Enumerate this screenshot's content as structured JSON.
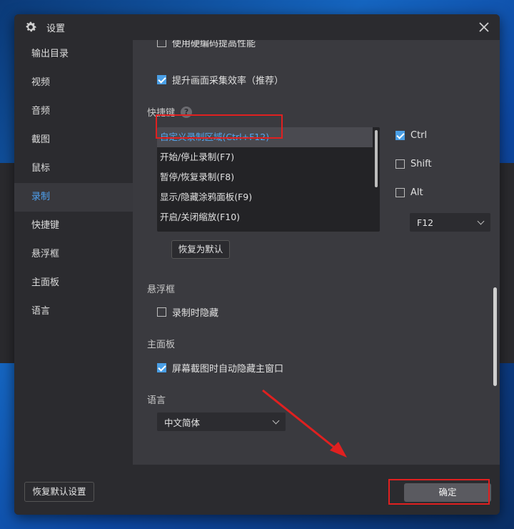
{
  "window": {
    "title": "设置",
    "close_icon": "close-icon",
    "settings_icon": "gear-icon"
  },
  "sidebar": {
    "items": [
      {
        "label": "输出目录",
        "active": false
      },
      {
        "label": "视频",
        "active": false
      },
      {
        "label": "音频",
        "active": false
      },
      {
        "label": "截图",
        "active": false
      },
      {
        "label": "鼠标",
        "active": false
      },
      {
        "label": "录制",
        "active": true
      },
      {
        "label": "快捷键",
        "active": false
      },
      {
        "label": "悬浮框",
        "active": false
      },
      {
        "label": "主面板",
        "active": false
      },
      {
        "label": "语言",
        "active": false
      }
    ]
  },
  "recording": {
    "hw_encode_label": "使用硬编码提高性能",
    "hw_encode_checked": false,
    "capture_efficiency_label": "提升画面采集效率（推荐）",
    "capture_efficiency_checked": true
  },
  "hotkeys": {
    "section_title": "快捷键",
    "help_icon": "help-icon",
    "list": [
      {
        "label": "自定义录制区域(Ctrl+F12)",
        "selected": true
      },
      {
        "label": "开始/停止录制(F7)",
        "selected": false
      },
      {
        "label": "暂停/恢复录制(F8)",
        "selected": false
      },
      {
        "label": "显示/隐藏涂鸦面板(F9)",
        "selected": false
      },
      {
        "label": "开启/关闭缩放(F10)",
        "selected": false
      }
    ],
    "ctrl_label": "Ctrl",
    "ctrl_checked": true,
    "shift_label": "Shift",
    "shift_checked": false,
    "alt_label": "Alt",
    "alt_checked": false,
    "key_value": "F12",
    "reset_label": "恢复为默认"
  },
  "float": {
    "section_title": "悬浮框",
    "hide_label": "录制时隐藏",
    "hide_checked": false
  },
  "panel": {
    "section_title": "主面板",
    "auto_hide_label": "屏幕截图时自动隐藏主窗口",
    "auto_hide_checked": true
  },
  "language": {
    "section_title": "语言",
    "value": "中文简体"
  },
  "footer": {
    "reset_all_label": "恢复默认设置",
    "ok_label": "确定"
  },
  "annotation_color": "#e02020",
  "accent_color": "#4a9fe6"
}
